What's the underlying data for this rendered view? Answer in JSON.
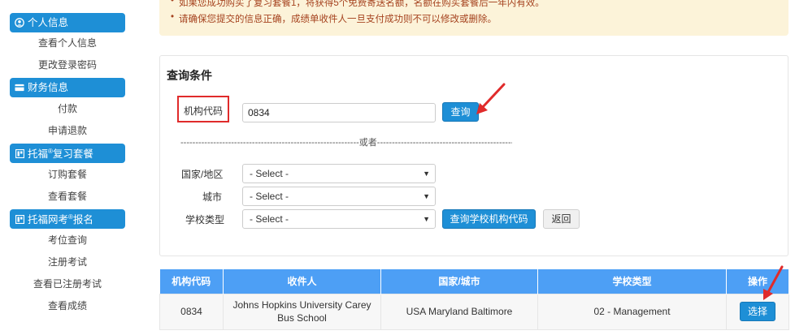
{
  "sidebar": {
    "sections": [
      {
        "title": "个人信息",
        "icon": "user-circle-icon",
        "items": [
          "查看个人信息",
          "更改登录密码"
        ]
      },
      {
        "title": "财务信息",
        "icon": "credit-card-icon",
        "items": [
          "付款",
          "申请退款"
        ]
      },
      {
        "title_pre": "托福",
        "title_sup": "®",
        "title_post": "复习套餐",
        "icon": "book-icon",
        "items": [
          "订购套餐",
          "查看套餐"
        ]
      },
      {
        "title_pre": "托福网考",
        "title_sup": "®",
        "title_post": "报名",
        "icon": "book-icon",
        "items": [
          "考位查询",
          "注册考试",
          "查看已注册考试",
          "查看成绩"
        ]
      }
    ]
  },
  "notice": {
    "line1": "如果您成功购买了复习套餐1，将获得5个免费寄送名额，名额在购买套餐后一年内有效。",
    "line2": "请确保您提交的信息正确，成绩单收件人一旦支付成功则不可以修改或删除。"
  },
  "query": {
    "title": "查询条件",
    "code_label": "机构代码",
    "code_value": "0834",
    "search_button": "查询",
    "divider": "------------------------------------------------------------或者------------------------------------------------------------",
    "country_label": "国家/地区",
    "city_label": "城市",
    "school_type_label": "学校类型",
    "select_placeholder": "- Select -",
    "find_code_button": "查询学校机构代码",
    "back_button": "返回"
  },
  "table": {
    "headers": [
      "机构代码",
      "收件人",
      "国家/城市",
      "学校类型",
      "操作"
    ],
    "rows": [
      {
        "code": "0834",
        "recipient": "Johns Hopkins University Carey Bus School",
        "location": "USA Maryland Baltimore",
        "school_type": "02 - Management",
        "action": "选择"
      }
    ]
  },
  "colors": {
    "accent": "#1e8fd6",
    "header": "#4d9ff5",
    "highlight": "#e02b2b",
    "notice_bg": "#fcf3d9",
    "notice_text": "#a5421e"
  }
}
